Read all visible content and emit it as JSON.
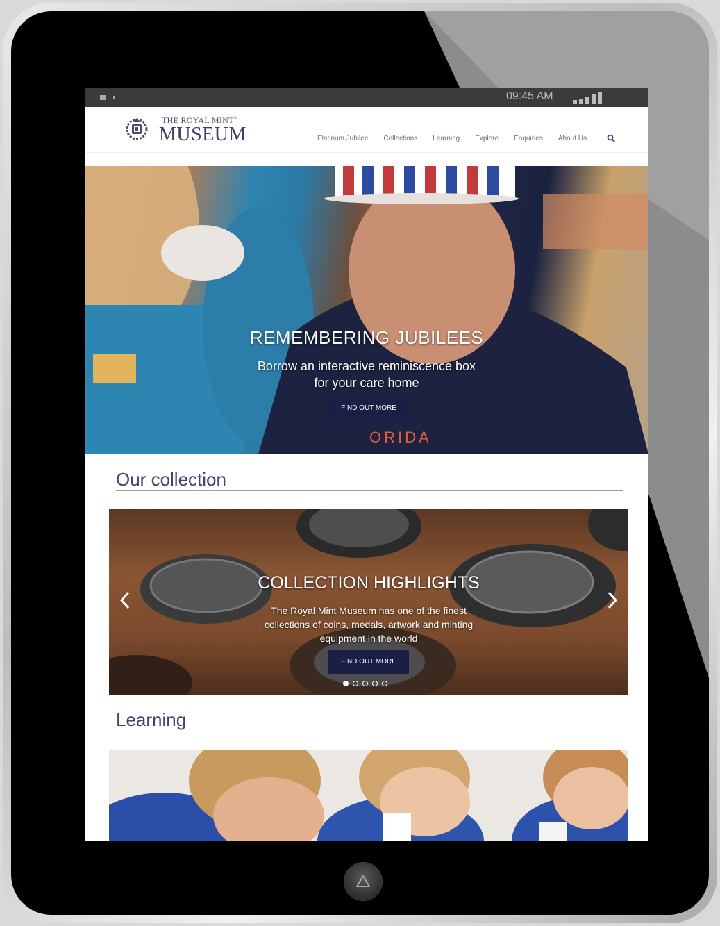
{
  "status_bar": {
    "time": "09:45 AM"
  },
  "logo": {
    "top": "THE ROYAL MINT",
    "trademark": "®",
    "main": "MUSEUM"
  },
  "nav": {
    "items": [
      {
        "label": "Platinum Jubilee"
      },
      {
        "label": "Collections"
      },
      {
        "label": "Learning"
      },
      {
        "label": "Explore"
      },
      {
        "label": "Enquiries"
      },
      {
        "label": "About Us"
      }
    ]
  },
  "hero": {
    "title": "REMEMBERING JUBILEES",
    "subtitle_line1": "Borrow an interactive reminiscence box",
    "subtitle_line2": "for your care home",
    "button": "FIND OUT MORE",
    "shirt_text": "ORIDA"
  },
  "collection": {
    "heading": "Our collection",
    "slide_title": "COLLECTION HIGHLIGHTS",
    "slide_line1": "The Royal Mint Museum has one of the finest",
    "slide_line2": "collections of coins, medals, artwork and minting",
    "slide_line3": "equipment in the world",
    "button": "FIND OUT MORE",
    "slide_count": 5,
    "active_slide": 1
  },
  "learning": {
    "heading": "Learning"
  },
  "colors": {
    "navy": "#1d1e45",
    "heading": "#3e4566",
    "status_bar": "#3b3b3b"
  },
  "icons": [
    "battery-icon",
    "signal-icon",
    "crest-icon",
    "search-icon",
    "chevron-left-icon",
    "chevron-right-icon",
    "home-button-icon"
  ]
}
